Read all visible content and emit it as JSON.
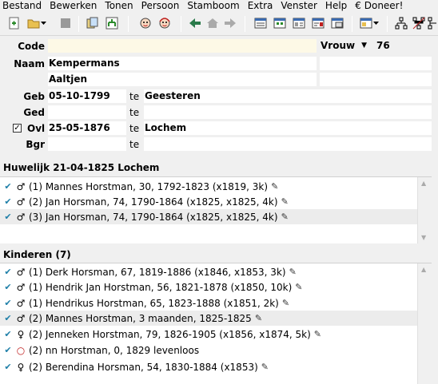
{
  "menu": [
    "Bestand",
    "Bewerken",
    "Tonen",
    "Persoon",
    "Stamboom",
    "Extra",
    "Venster",
    "Help",
    "€ Doneer!"
  ],
  "toolbar": {
    "icons": [
      "new-person-icon",
      "open-folder-icon",
      "dropdown-arrow-icon",
      "stop-icon",
      "copy-icon",
      "tree-icon",
      "male-face-icon",
      "female-face-icon",
      "back-arrow-icon",
      "home-icon",
      "forward-arrow-icon",
      "list-view-icon",
      "detail-view-icon",
      "card-view-icon",
      "report-view-icon",
      "window-icon",
      "pedigree-icon",
      "descendants-icon",
      "family-icon"
    ]
  },
  "person": {
    "code_label": "Code",
    "code_value": "",
    "gender": "Vrouw",
    "age": "76",
    "naam_label": "Naam",
    "surname": "Kempermans",
    "firstname": "Aaltjen",
    "geb_label": "Geb",
    "geb_date": "05-10-1799",
    "geb_te": "te",
    "geb_place": "Geesteren",
    "ged_label": "Ged",
    "ged_date": "",
    "ged_te": "te",
    "ged_place": "",
    "ovl_checked": "☑",
    "ovl_label": "Ovl",
    "ovl_date": "25-05-1876",
    "ovl_te": "te",
    "ovl_place": "Lochem",
    "bgr_label": "Bgr",
    "bgr_date": "",
    "bgr_te": "te",
    "bgr_place": ""
  },
  "marriage": {
    "header": "Huwelijk 21-04-1825 Lochem",
    "rows": [
      {
        "check": "✔",
        "gender": "♂",
        "text": "(1) Mannes Horstman, 30, 1792-1823 (x1819, 3k)"
      },
      {
        "check": "✔",
        "gender": "♂",
        "text": "(2) Jan Horsman, 74, 1790-1864 (x1825, x1825, 4k)"
      },
      {
        "check": "✔",
        "gender": "♂",
        "text": "(3) Jan Horsman, 74, 1790-1864 (x1825, x1825, 4k)"
      }
    ]
  },
  "children": {
    "header": "Kinderen (7)",
    "rows": [
      {
        "check": "✔",
        "gender": "♂",
        "text": "(1) Derk Horsman, 67, 1819-1886 (x1846, x1853, 3k)"
      },
      {
        "check": "✔",
        "gender": "♂",
        "text": "(1) Hendrik Jan Horstman, 56, 1821-1878 (x1850, 10k)"
      },
      {
        "check": "✔",
        "gender": "♂",
        "text": "(1) Hendrikus Horstman, 65, 1823-1888 (x1851, 2k)"
      },
      {
        "check": "✔",
        "gender": "♂",
        "text": "(2) Mannes Horstman, 3 maanden, 1825-1825"
      },
      {
        "check": "✔",
        "gender": "♀",
        "text": "(2) Jenneken Horstman, 79, 1826-1905 (x1856, x1874, 5k)"
      },
      {
        "check": "✔",
        "gender": "○",
        "text": "(2) nn Horstman, 0, 1829 levenloos"
      },
      {
        "check": "✔",
        "gender": "♀",
        "text": "(2) Berendina Horsman, 54, 1830-1884 (x1853)"
      }
    ]
  }
}
